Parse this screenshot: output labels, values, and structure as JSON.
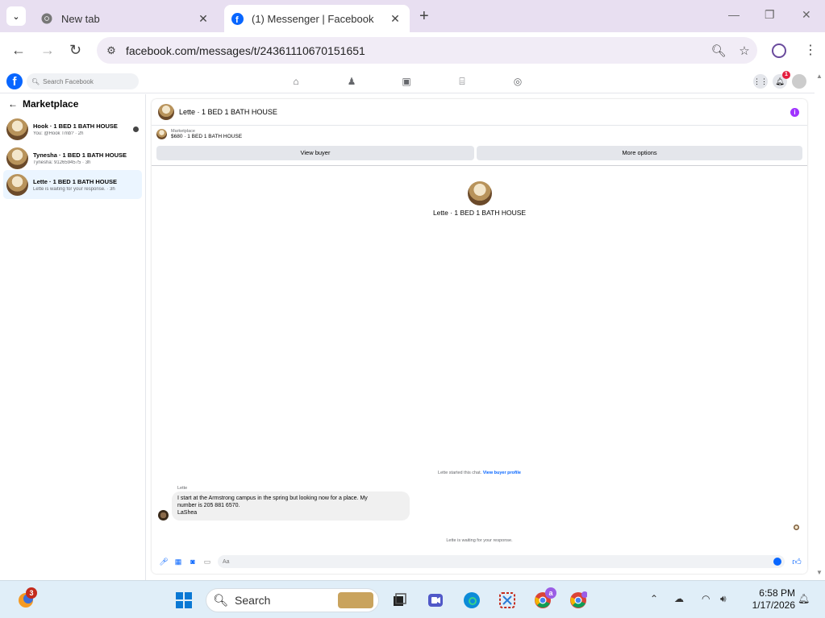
{
  "browser": {
    "tabs": [
      {
        "title": "New tab",
        "icon": "chrome-icon"
      },
      {
        "title": "(1) Messenger | Facebook",
        "icon": "facebook-icon"
      }
    ],
    "url": "facebook.com/messages/t/24361110670151651"
  },
  "facebook": {
    "search_placeholder": "Search Facebook",
    "notification_count": "1"
  },
  "sidebar": {
    "title": "Marketplace",
    "conversations": [
      {
        "name": "Hook · 1 BED 1 BATH HOUSE",
        "preview": "You: @Hook Tmb? · 2h",
        "selected": false
      },
      {
        "name": "Tynesha · 1 BED 1 BATH HOUSE",
        "preview": "Tynesha: 9126594575 · 3h",
        "selected": false
      },
      {
        "name": "Lette · 1 BED 1 BATH HOUSE",
        "preview": "Lette is waiting for your response. · 3h",
        "selected": true
      }
    ]
  },
  "chat": {
    "header_name": "Lette · 1 BED 1 BATH HOUSE",
    "listing_source": "Marketplace",
    "listing_title": "$680 · 1 BED 1 BATH HOUSE",
    "view_buyer_label": "View buyer",
    "more_options_label": "More options",
    "center_name": "Lette · 1 BED 1 BATH HOUSE",
    "started_text": "Lette started this chat.",
    "view_buyer_profile_link": "View buyer profile",
    "sender": "Lette",
    "message_lines": [
      "I start at the Armstrong campus in the spring but looking now for a place. My",
      "number is 205 881 6570.",
      "LaShea"
    ],
    "waiting_text": "Lette is waiting for your response.",
    "composer_placeholder": "Aa"
  },
  "taskbar": {
    "search_label": "Search",
    "clock_time": "6:58 PM",
    "clock_date": "1/17/2026",
    "weather_badge": "3",
    "chrome_profile_badge": "a"
  }
}
